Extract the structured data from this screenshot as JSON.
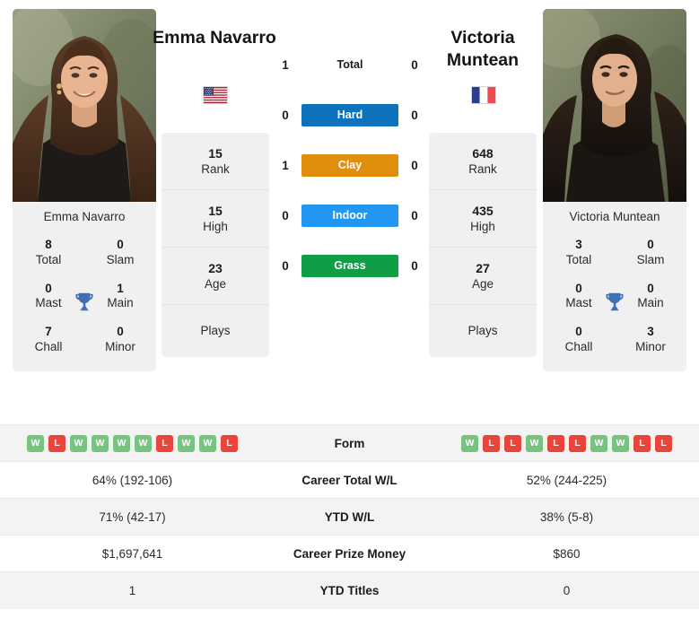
{
  "players": {
    "left": {
      "headline_name": "Emma Navarro",
      "card_name": "Emma Navarro",
      "flag": "us-flag-icon",
      "rank": "15",
      "rank_label": "Rank",
      "high": "15",
      "high_label": "High",
      "age": "23",
      "age_label": "Age",
      "plays_label": "Plays",
      "plays_value": "",
      "titles": [
        {
          "value": "8",
          "label": "Total"
        },
        {
          "value": "0",
          "label": "Slam"
        },
        {
          "value": "0",
          "label": "Mast"
        },
        {
          "value": "1",
          "label": "Main"
        },
        {
          "value": "7",
          "label": "Chall"
        },
        {
          "value": "0",
          "label": "Minor"
        }
      ],
      "form": [
        "W",
        "L",
        "W",
        "W",
        "W",
        "W",
        "L",
        "W",
        "W",
        "L"
      ],
      "career_total_wl": "64% (192-106)",
      "ytd_wl": "71% (42-17)",
      "career_prize_money": "$1,697,641",
      "ytd_titles": "1"
    },
    "right": {
      "headline_name": "Victoria Muntean",
      "card_name": "Victoria Muntean",
      "flag": "fr-flag-icon",
      "rank": "648",
      "rank_label": "Rank",
      "high": "435",
      "high_label": "High",
      "age": "27",
      "age_label": "Age",
      "plays_label": "Plays",
      "plays_value": "",
      "titles": [
        {
          "value": "3",
          "label": "Total"
        },
        {
          "value": "0",
          "label": "Slam"
        },
        {
          "value": "0",
          "label": "Mast"
        },
        {
          "value": "0",
          "label": "Main"
        },
        {
          "value": "0",
          "label": "Chall"
        },
        {
          "value": "3",
          "label": "Minor"
        }
      ],
      "form": [
        "W",
        "L",
        "L",
        "W",
        "L",
        "L",
        "W",
        "W",
        "L",
        "L"
      ],
      "career_total_wl": "52% (244-225)",
      "ytd_wl": "38% (5-8)",
      "career_prize_money": "$860",
      "ytd_titles": "0"
    }
  },
  "h2h": {
    "total": {
      "label": "Total",
      "left": "1",
      "right": "0"
    },
    "surfaces": [
      {
        "label": "Hard",
        "left": "0",
        "right": "0",
        "color": "#0b72bb"
      },
      {
        "label": "Clay",
        "left": "1",
        "right": "0",
        "color": "#e08e0b"
      },
      {
        "label": "Indoor",
        "left": "0",
        "right": "0",
        "color": "#2196f3"
      },
      {
        "label": "Grass",
        "left": "0",
        "right": "0",
        "color": "#0f9d45"
      }
    ]
  },
  "table": {
    "rows": [
      {
        "label": "Form",
        "left": "",
        "right": ""
      },
      {
        "label": "Career Total W/L",
        "left": "64% (192-106)",
        "right": "52% (244-225)"
      },
      {
        "label": "YTD W/L",
        "left": "71% (42-17)",
        "right": "38% (5-8)"
      },
      {
        "label": "Career Prize Money",
        "left": "$1,697,641",
        "right": "$860"
      },
      {
        "label": "YTD Titles",
        "left": "1",
        "right": "0"
      }
    ]
  },
  "colors": {
    "card_bg": "#f0f0f0",
    "row_stripe": "#f3f3f3",
    "win": "#77c380",
    "loss": "#e8453c",
    "trophy": "#3f6fb5"
  }
}
